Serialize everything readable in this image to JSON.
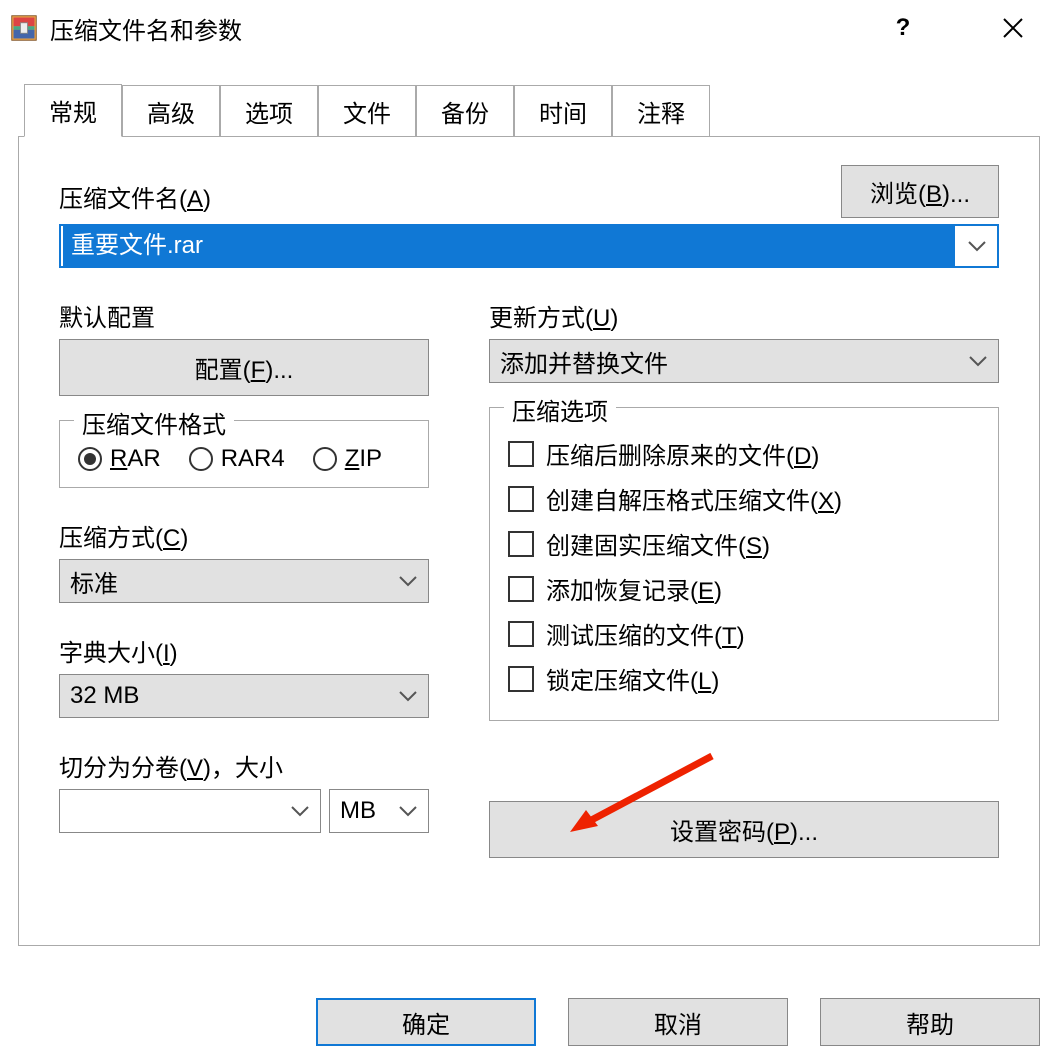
{
  "title": "压缩文件名和参数",
  "tabs": [
    "常规",
    "高级",
    "选项",
    "文件",
    "备份",
    "时间",
    "注释"
  ],
  "filename_label_pre": "压缩文件名(",
  "filename_label_u": "A",
  "filename_label_post": ")",
  "browse_pre": "浏览(",
  "browse_u": "B",
  "browse_post": ")...",
  "filename_value": "重要文件.rar",
  "default_profile_label": "默认配置",
  "profiles_pre": "配置(",
  "profiles_u": "F",
  "profiles_post": ")...",
  "update_label_pre": "更新方式(",
  "update_label_u": "U",
  "update_label_post": ")",
  "update_value": "添加并替换文件",
  "format_legend": "压缩文件格式",
  "formats": [
    {
      "u": "R",
      "rest": "AR",
      "checked": true
    },
    {
      "u": "",
      "rest": "RAR4",
      "checked": false
    },
    {
      "u": "Z",
      "rest": "IP",
      "checked": false
    }
  ],
  "method_label_pre": "压缩方式(",
  "method_label_u": "C",
  "method_label_post": ")",
  "method_value": "标准",
  "dict_label_pre": "字典大小(",
  "dict_label_u": "I",
  "dict_label_post": ")",
  "dict_value": "32 MB",
  "split_label_pre": "切分为分卷(",
  "split_label_u": "V",
  "split_label_post": ")，大小",
  "split_value": "",
  "split_unit": "MB",
  "options_legend": "压缩选项",
  "options": [
    {
      "text_pre": "压缩后删除原来的文件(",
      "u": "D",
      "text_post": ")"
    },
    {
      "text_pre": "创建自解压格式压缩文件(",
      "u": "X",
      "text_post": ")"
    },
    {
      "text_pre": "创建固实压缩文件(",
      "u": "S",
      "text_post": ")"
    },
    {
      "text_pre": "添加恢复记录(",
      "u": "E",
      "text_post": ")"
    },
    {
      "text_pre": "测试压缩的文件(",
      "u": "T",
      "text_post": ")"
    },
    {
      "text_pre": "锁定压缩文件(",
      "u": "L",
      "text_post": ")"
    }
  ],
  "password_pre": "设置密码(",
  "password_u": "P",
  "password_post": ")...",
  "footer": {
    "ok": "确定",
    "cancel": "取消",
    "help": "帮助"
  }
}
